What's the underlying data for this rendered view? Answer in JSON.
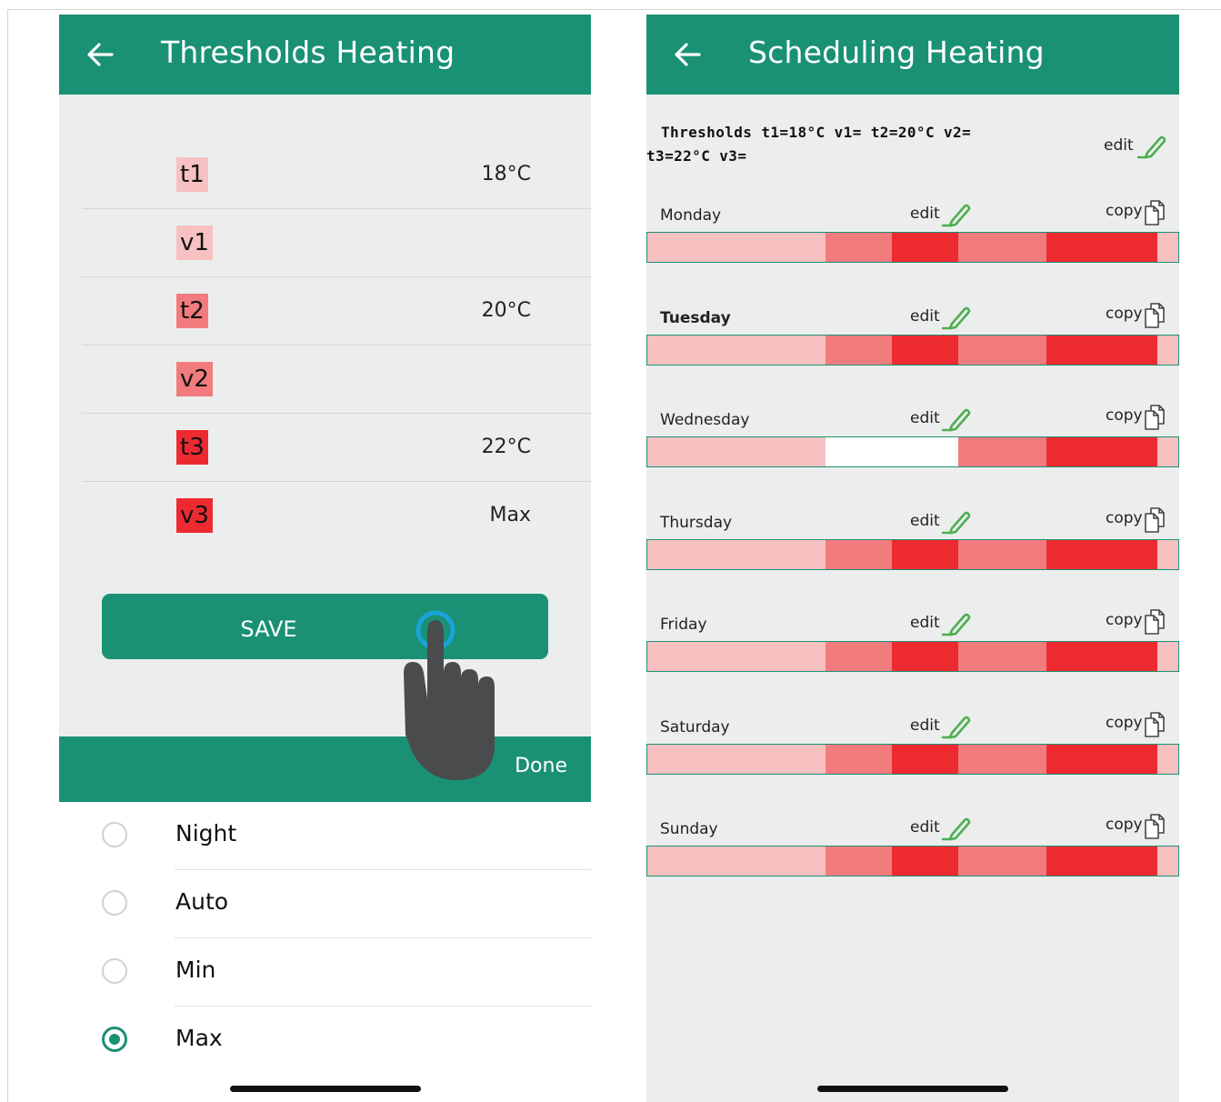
{
  "left": {
    "title": "Thresholds Heating",
    "thresholds": [
      {
        "label": "t1",
        "value": "18°C",
        "color": "#f8c1c1"
      },
      {
        "label": "v1",
        "value": "",
        "color": "#f8c1c1"
      },
      {
        "label": "t2",
        "value": "20°C",
        "color": "#f27b7d"
      },
      {
        "label": "v2",
        "value": "",
        "color": "#f27b7d"
      },
      {
        "label": "t3",
        "value": "22°C",
        "color": "#ee2a31"
      },
      {
        "label": "v3",
        "value": "Max",
        "color": "#ee2a31"
      }
    ],
    "save_label": "SAVE",
    "done_label": "Done",
    "options": [
      {
        "label": "Night",
        "selected": false
      },
      {
        "label": "Auto",
        "selected": false
      },
      {
        "label": "Min",
        "selected": false
      },
      {
        "label": "Max",
        "selected": true
      }
    ]
  },
  "right": {
    "title": "Scheduling Heating",
    "thresholds_line1": "Thresholds t1=18°C v1= t2=20°C v2=",
    "thresholds_line2": "t3=22°C v3=",
    "edit_label": "edit",
    "copy_label": "copy",
    "days": [
      {
        "name": "Monday",
        "bold": false,
        "segments": [
          "c1",
          "c1",
          "c2",
          "c3",
          "c2",
          "c3",
          "c1"
        ]
      },
      {
        "name": "Tuesday",
        "bold": true,
        "segments": [
          "c1",
          "c1",
          "c2",
          "c3",
          "c2",
          "c3",
          "c1"
        ]
      },
      {
        "name": "Wednesday",
        "bold": false,
        "segments": [
          "c1",
          "c1",
          "cw",
          "cw",
          "c2",
          "c3",
          "c1"
        ]
      },
      {
        "name": "Thursday",
        "bold": false,
        "segments": [
          "c1",
          "c1",
          "c2",
          "c3",
          "c2",
          "c3",
          "c1"
        ]
      },
      {
        "name": "Friday",
        "bold": false,
        "segments": [
          "c1",
          "c1",
          "c2",
          "c3",
          "c2",
          "c3",
          "c1"
        ]
      },
      {
        "name": "Saturday",
        "bold": false,
        "segments": [
          "c1",
          "c1",
          "c2",
          "c3",
          "c2",
          "c3",
          "c1"
        ]
      },
      {
        "name": "Sunday",
        "bold": false,
        "segments": [
          "c1",
          "c1",
          "c2",
          "c3",
          "c2",
          "c3",
          "c1"
        ]
      }
    ]
  },
  "colors": {
    "primary": "#1a9174",
    "background": "#eceeed",
    "level_low": "#f8c1c1",
    "level_mid": "#f27b7d",
    "level_high": "#ee2a31",
    "edit_pencil": "#4caf50"
  },
  "icons": [
    "back-arrow-icon",
    "pencil-icon",
    "copy-icon",
    "hand-pointer-icon",
    "radio-button"
  ]
}
